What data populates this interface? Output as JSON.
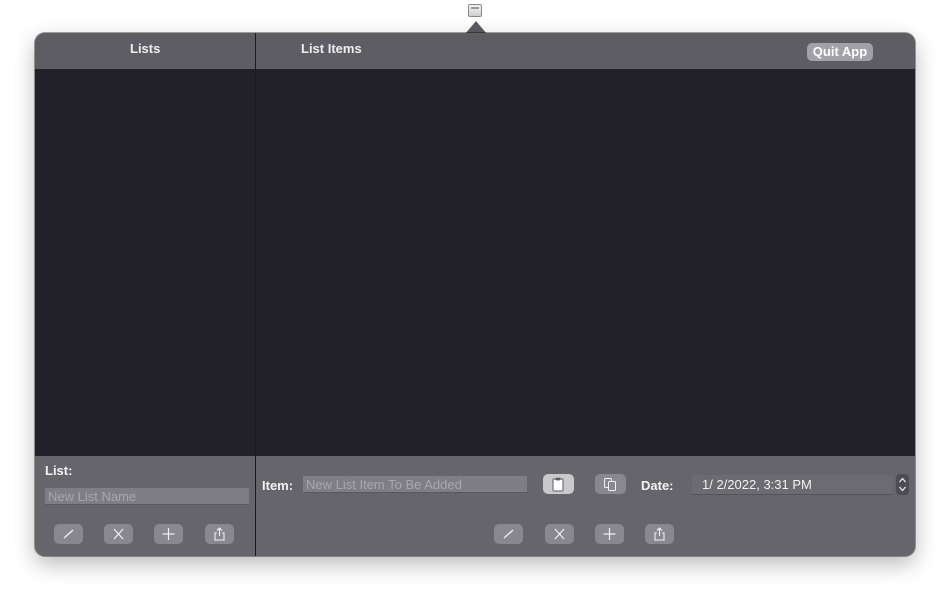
{
  "header": {
    "lists_title": "Lists",
    "items_title": "List Items",
    "quit_label": "Quit App"
  },
  "list_form": {
    "label": "List:",
    "name_placeholder": "New List Name",
    "name_value": ""
  },
  "item_form": {
    "label": "Item:",
    "item_placeholder": "New List Item To Be Added",
    "item_value": "",
    "date_label": "Date:",
    "date_value": "1/  2/2022,   3:31 PM"
  },
  "icons": {
    "status_item": "app-window-icon",
    "edit": "pencil-icon",
    "delete": "x-icon",
    "add": "plus-icon",
    "share": "share-icon",
    "paste": "paste-icon",
    "copy": "copy-icon",
    "stepper": "up-down-stepper-icon"
  },
  "colors": {
    "pane_background": "#222029",
    "chrome": "#65636a"
  }
}
